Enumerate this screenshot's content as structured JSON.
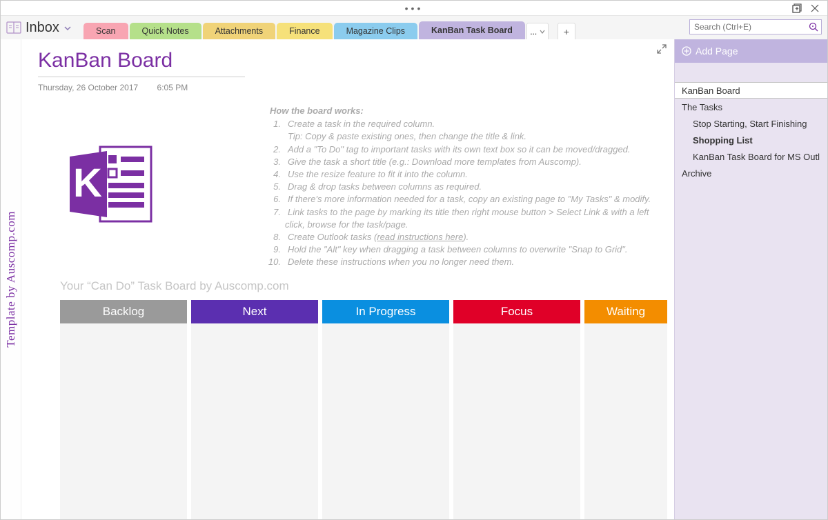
{
  "window": {
    "dots": "•••"
  },
  "notebook": {
    "label": "Inbox"
  },
  "tabs": {
    "scan": "Scan",
    "quick": "Quick Notes",
    "attachments": "Attachments",
    "finance": "Finance",
    "magazine": "Magazine Clips",
    "active": "KanBan Task Board",
    "overflow": "...",
    "add": "+"
  },
  "search": {
    "placeholder": "Search (Ctrl+E)"
  },
  "brand": "Template by Auscomp.com",
  "page": {
    "title": "KanBan Board",
    "date": "Thursday, 26 October 2017",
    "time": "6:05 PM"
  },
  "instructions": {
    "heading": "How the board works:",
    "i1": "Create a task in the required column.",
    "i1b": "Tip: Copy & paste existing ones, then change the title & link.",
    "i2": "Add a \"To Do\" tag to important tasks with its own text box so it can be moved/dragged.",
    "i3": "Give the task a short title (e.g.: Download more templates from Auscomp).",
    "i4": "Use the resize feature to fit it into the column.",
    "i5": "Drag & drop tasks between columns as required.",
    "i6": "If there's more information needed for a task, copy an existing page to \"My Tasks\" & modify.",
    "i7": "Link tasks to the page by marking its title then right mouse button > Select Link & with a left click, browse for the task/page.",
    "i8a": "Create Outlook tasks (",
    "i8b": "read instructions here",
    "i8c": ").",
    "i9": "Hold the \"Alt\" key when dragging a task between columns to overwrite \"Snap to Grid\".",
    "i10": "Delete these instructions when you no longer need them."
  },
  "board": {
    "label": "Your “Can Do” Task Board by Auscomp.com",
    "backlog": "Backlog",
    "next": "Next",
    "progress": "In Progress",
    "focus": "Focus",
    "waiting": "Waiting"
  },
  "sidebar": {
    "addPage": "Add Page",
    "p1": "KanBan Board",
    "p2": "The Tasks",
    "p3": "Stop Starting, Start Finishing",
    "p4": "Shopping List",
    "p5": "KanBan Task Board for MS Outl",
    "p6": "Archive"
  }
}
